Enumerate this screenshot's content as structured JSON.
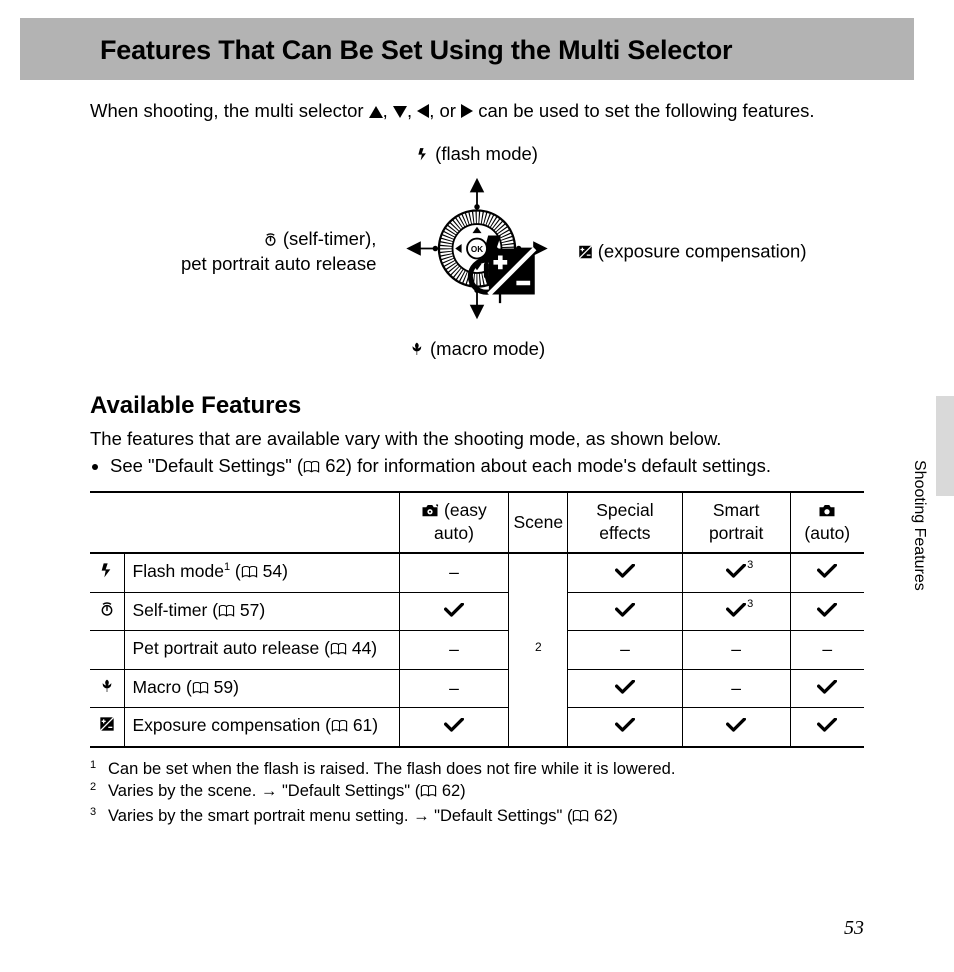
{
  "header_title": "Features That Can Be Set Using the Multi Selector",
  "intro_a": "When shooting, the multi selector ",
  "intro_b": ", ",
  "intro_c": ", ",
  "intro_d": ", or ",
  "intro_e": " can be used to set the following features.",
  "diagram": {
    "top": " (flash mode)",
    "bottom": " (macro mode)",
    "left_line1": " (self-timer),",
    "left_line2": "pet portrait auto release",
    "right": " (exposure compensation)",
    "ok": "OK"
  },
  "section2_title": "Available Features",
  "section2_line": "The features that are available vary with the shooting mode, as shown below.",
  "section2_bullet_a": "See \"Default Settings\" (",
  "section2_bullet_b": " 62) for information about each mode's default settings.",
  "table": {
    "headers": {
      "easy_auto": " (easy auto)",
      "scene": "Scene",
      "special": "Special effects",
      "smart": "Smart portrait",
      "auto": " (auto)"
    },
    "scene_footnote": "2",
    "rows": [
      {
        "id": "flash",
        "name_a": "Flash mode",
        "sup": "1",
        "page": "54",
        "cells": [
          "–",
          null,
          "✔",
          "✔3",
          "✔"
        ]
      },
      {
        "id": "timer",
        "name_a": "Self-timer",
        "sup": "",
        "page": "57",
        "cells": [
          "✔",
          null,
          "✔",
          "✔3",
          "✔"
        ]
      },
      {
        "id": "pet",
        "name_a": "Pet portrait auto release",
        "sup": "",
        "page": "44",
        "cells": [
          "–",
          null,
          "–",
          "–",
          "–"
        ]
      },
      {
        "id": "macro",
        "name_a": "Macro",
        "sup": "",
        "page": "59",
        "cells": [
          "–",
          null,
          "✔",
          "–",
          "✔"
        ]
      },
      {
        "id": "exp",
        "name_a": "Exposure compensation",
        "sup": "",
        "page": "61",
        "cells": [
          "✔",
          null,
          "✔",
          "✔",
          "✔"
        ]
      }
    ]
  },
  "footnotes": [
    {
      "n": "1",
      "t": "Can be set when the flash is raised. The flash does not fire while it is lowered."
    },
    {
      "n": "2",
      "t_a": "Varies by the scene. → \"Default Settings\" (",
      "t_b": " 62)"
    },
    {
      "n": "3",
      "t_a": "Varies by the smart portrait menu setting. → \"Default Settings\" (",
      "t_b": " 62)"
    }
  ],
  "side_tab": "Shooting Features",
  "page_number": "53"
}
